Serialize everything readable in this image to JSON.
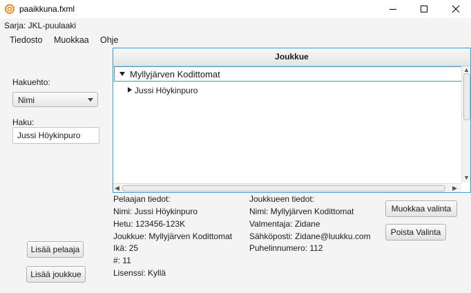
{
  "window": {
    "title": "paaikkuna.fxml",
    "controls": [
      "minimize-icon",
      "maximize-icon",
      "close-icon"
    ]
  },
  "subtitle": "Sarja: JKL-puulaaki",
  "menu": {
    "items": [
      "Tiedosto",
      "Muokkaa",
      "Ohje"
    ]
  },
  "search": {
    "criteria_label": "Hakuehto:",
    "criteria_value": "Nimi",
    "query_label": "Haku:",
    "query_value": "Jussi Höykinpuro"
  },
  "tree": {
    "header": "Joukkue",
    "root": "Myllyjärven Kodittomat",
    "child": "Jussi Höykinpuro"
  },
  "player": {
    "heading": "Pelaajan tiedot:",
    "lines": [
      "Nimi: Jussi Höykinpuro",
      "Hetu: 123456-123K",
      "Joukkue: Myllyjärven Kodittomat",
      "Ikä: 25",
      "#: 11",
      "Lisenssi: Kyllä"
    ]
  },
  "team": {
    "heading": "Joukkueen tiedot:",
    "lines": [
      "Nimi: Myllyjärven Kodittomat",
      "Valmentaja: Zidane",
      "Sähköposti: Zidane@luukku.com",
      "Puhelinnumero: 112"
    ]
  },
  "buttons": {
    "edit": "Muokkaa valinta",
    "delete": "Poista Valinta",
    "add_player": "Lisää pelaaja",
    "add_team": "Lisää joukkue"
  },
  "colors": {
    "focus_border": "#3a9bd0",
    "app_icon": "#f08a24"
  }
}
